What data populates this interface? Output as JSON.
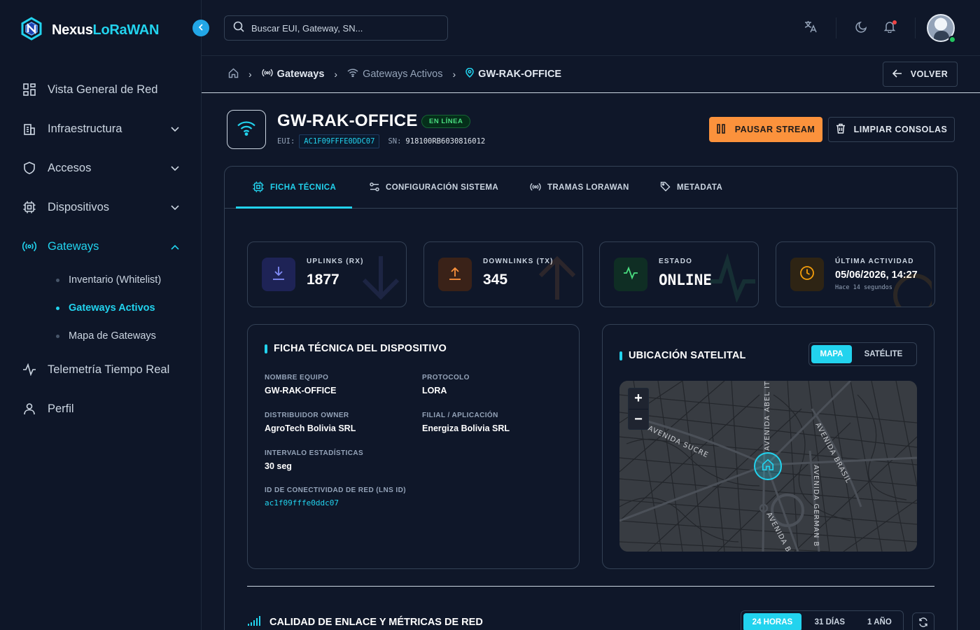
{
  "app": {
    "brand_main": "Nexus",
    "brand_accent": "LoRaWAN",
    "accent_color": "#22d3ee",
    "warning_color": "#fb923c",
    "success_color": "#4ade80"
  },
  "sidebar": {
    "items": [
      {
        "label": "Vista General de Red",
        "icon": "dashboard-icon"
      },
      {
        "label": "Infraestructura",
        "icon": "building-icon"
      },
      {
        "label": "Accesos",
        "icon": "shield-icon"
      },
      {
        "label": "Dispositivos",
        "icon": "chip-icon"
      },
      {
        "label": "Gateways",
        "icon": "radio-icon"
      },
      {
        "label": "Telemetría Tiempo Real",
        "icon": "activity-icon"
      },
      {
        "label": "Perfil",
        "icon": "user-icon"
      }
    ],
    "gateways_sub": [
      "Inventario (Whitelist)",
      "Gateways Activos",
      "Mapa de Gateways"
    ]
  },
  "topbar": {
    "search_placeholder": "Buscar EUI, Gateway, SN..."
  },
  "breadcrumb": {
    "items": [
      "Gateways",
      "Gateways Activos",
      "GW-RAK-OFFICE"
    ],
    "back_label": "VOLVER"
  },
  "device": {
    "name": "GW-RAK-OFFICE",
    "status": "EN LÍNEA",
    "eui_label": "EUI:",
    "eui": "AC1F09FFFE0DDC07",
    "sn_label": "SN:",
    "sn": "918100RB6030816012"
  },
  "actions": {
    "pause": "PAUSAR STREAM",
    "clear": "LIMPIAR CONSOLAS"
  },
  "tabs": [
    "FICHA TÉCNICA",
    "CONFIGURACIÓN SISTEMA",
    "TRAMAS LORAWAN",
    "METADATA"
  ],
  "stats": [
    {
      "label": "UPLINKS (RX)",
      "value": "1877"
    },
    {
      "label": "DOWNLINKS (TX)",
      "value": "345"
    },
    {
      "label": "ESTADO",
      "value": "ONLINE"
    },
    {
      "label": "ÚLTIMA ACTIVIDAD",
      "value": "05/06/2026, 14:27",
      "sub": "Hace 14 segundos"
    }
  ],
  "ficha": {
    "title": "FICHA TÉCNICA DEL DISPOSITIVO",
    "fields": [
      {
        "label": "NOMBRE EQUIPO",
        "value": "GW-RAK-OFFICE"
      },
      {
        "label": "PROTOCOLO",
        "value": "LORA"
      },
      {
        "label": "DISTRIBUIDOR OWNER",
        "value": "AgroTech Bolivia SRL"
      },
      {
        "label": "FILIAL / APLICACIÓN",
        "value": "Energiza Bolivia SRL"
      },
      {
        "label": "INTERVALO ESTADÍSTICAS",
        "value": "30 seg"
      },
      {
        "label": "ID DE CONECTIVIDAD DE RED (LNS ID)",
        "value": "ac1f09fffe0ddc07"
      }
    ]
  },
  "ubicacion": {
    "title": "UBICACIÓN SATELITAL",
    "modes": [
      "MAPA",
      "SATÉLITE"
    ],
    "zoom_in": "+",
    "zoom_out": "−",
    "streets": [
      "AVENIDA SUCRE",
      "AVENIDA ABEL ITU",
      "AVENIDA BRASIL",
      "AVENIDA GERMAN B",
      "AVENIDA B"
    ]
  },
  "calidad": {
    "title": "CALIDAD DE ENLACE Y MÉTRICAS DE RED",
    "ranges": [
      "24 HORAS",
      "31 DÍAS",
      "1 AÑO"
    ]
  }
}
